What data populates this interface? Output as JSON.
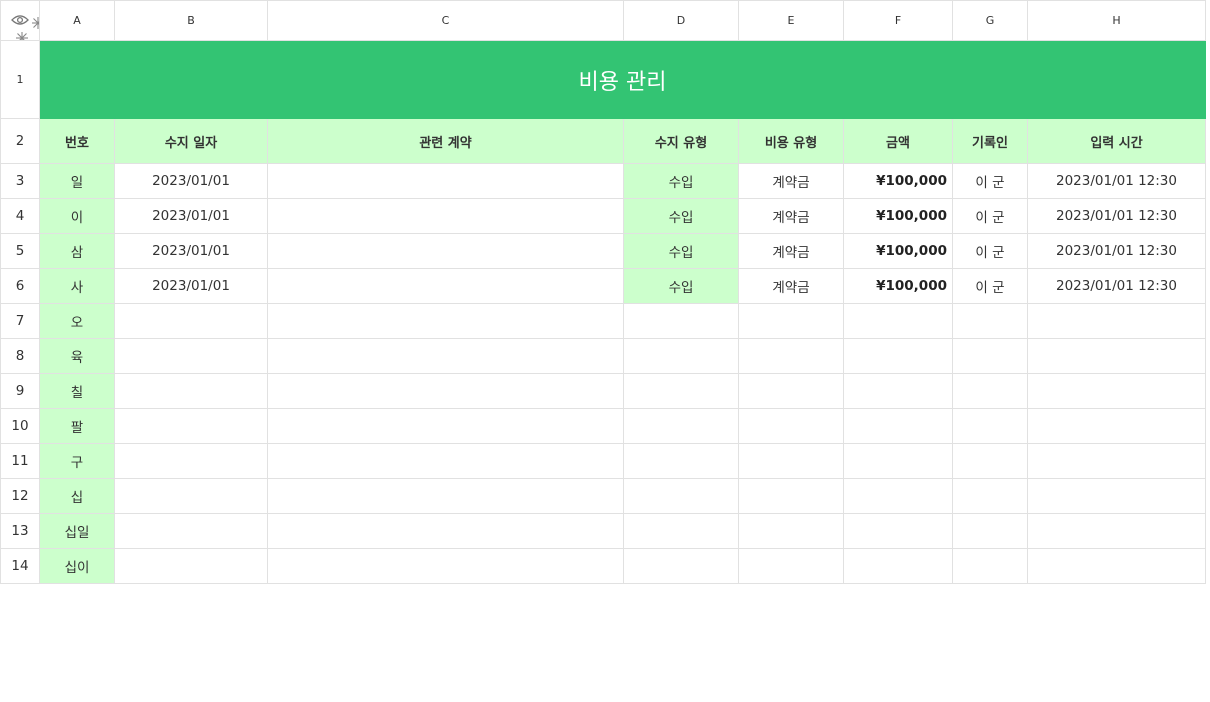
{
  "columns": [
    "A",
    "B",
    "C",
    "D",
    "E",
    "F",
    "G",
    "H"
  ],
  "title": "비용 관리",
  "headers": [
    "번호",
    "수지 일자",
    "관련 계약",
    "수지 유형",
    "비용 유형",
    "금액",
    "기록인",
    "입력 시간"
  ],
  "rows": [
    {
      "num": "3",
      "a": "일",
      "b": "2023/01/01",
      "c": "",
      "d": "수입",
      "e": "계약금",
      "f": "¥100,000",
      "g": "이 군",
      "h": "2023/01/01 12:30"
    },
    {
      "num": "4",
      "a": "이",
      "b": "2023/01/01",
      "c": "",
      "d": "수입",
      "e": "계약금",
      "f": "¥100,000",
      "g": "이 군",
      "h": "2023/01/01 12:30"
    },
    {
      "num": "5",
      "a": "삼",
      "b": "2023/01/01",
      "c": "",
      "d": "수입",
      "e": "계약금",
      "f": "¥100,000",
      "g": "이 군",
      "h": "2023/01/01 12:30"
    },
    {
      "num": "6",
      "a": "사",
      "b": "2023/01/01",
      "c": "",
      "d": "수입",
      "e": "계약금",
      "f": "¥100,000",
      "g": "이 군",
      "h": "2023/01/01 12:30"
    },
    {
      "num": "7",
      "a": "오",
      "b": "",
      "c": "",
      "d": "",
      "e": "",
      "f": "",
      "g": "",
      "h": ""
    },
    {
      "num": "8",
      "a": "육",
      "b": "",
      "c": "",
      "d": "",
      "e": "",
      "f": "",
      "g": "",
      "h": ""
    },
    {
      "num": "9",
      "a": "칠",
      "b": "",
      "c": "",
      "d": "",
      "e": "",
      "f": "",
      "g": "",
      "h": ""
    },
    {
      "num": "10",
      "a": "팔",
      "b": "",
      "c": "",
      "d": "",
      "e": "",
      "f": "",
      "g": "",
      "h": ""
    },
    {
      "num": "11",
      "a": "구",
      "b": "",
      "c": "",
      "d": "",
      "e": "",
      "f": "",
      "g": "",
      "h": ""
    },
    {
      "num": "12",
      "a": "십",
      "b": "",
      "c": "",
      "d": "",
      "e": "",
      "f": "",
      "g": "",
      "h": ""
    },
    {
      "num": "13",
      "a": "십일",
      "b": "",
      "c": "",
      "d": "",
      "e": "",
      "f": "",
      "g": "",
      "h": ""
    },
    {
      "num": "14",
      "a": "십이",
      "b": "",
      "c": "",
      "d": "",
      "e": "",
      "f": "",
      "g": "",
      "h": ""
    }
  ],
  "row_labels": {
    "title": "1",
    "header": "2"
  },
  "colors": {
    "title_bg": "#33c473",
    "header_bg": "#ccffcc",
    "grid": "#e1e1e1"
  },
  "icons": [
    "eye-icon",
    "freeze-columns-icon",
    "freeze-rows-icon"
  ]
}
